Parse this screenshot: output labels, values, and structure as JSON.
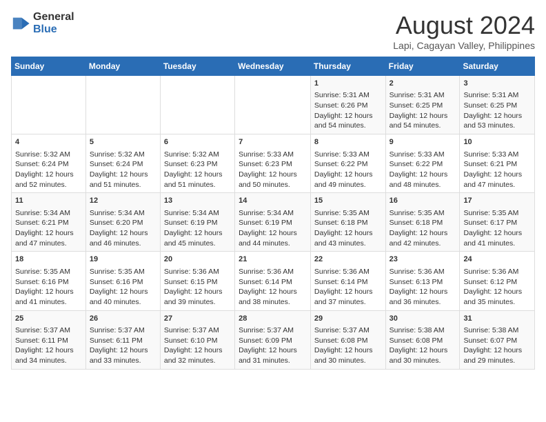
{
  "header": {
    "logo_general": "General",
    "logo_blue": "Blue",
    "month_title": "August 2024",
    "location": "Lapi, Cagayan Valley, Philippines"
  },
  "days_of_week": [
    "Sunday",
    "Monday",
    "Tuesday",
    "Wednesday",
    "Thursday",
    "Friday",
    "Saturday"
  ],
  "weeks": [
    [
      {
        "day": "",
        "info": ""
      },
      {
        "day": "",
        "info": ""
      },
      {
        "day": "",
        "info": ""
      },
      {
        "day": "",
        "info": ""
      },
      {
        "day": "1",
        "info": "Sunrise: 5:31 AM\nSunset: 6:26 PM\nDaylight: 12 hours\nand 54 minutes."
      },
      {
        "day": "2",
        "info": "Sunrise: 5:31 AM\nSunset: 6:25 PM\nDaylight: 12 hours\nand 54 minutes."
      },
      {
        "day": "3",
        "info": "Sunrise: 5:31 AM\nSunset: 6:25 PM\nDaylight: 12 hours\nand 53 minutes."
      }
    ],
    [
      {
        "day": "4",
        "info": "Sunrise: 5:32 AM\nSunset: 6:24 PM\nDaylight: 12 hours\nand 52 minutes."
      },
      {
        "day": "5",
        "info": "Sunrise: 5:32 AM\nSunset: 6:24 PM\nDaylight: 12 hours\nand 51 minutes."
      },
      {
        "day": "6",
        "info": "Sunrise: 5:32 AM\nSunset: 6:23 PM\nDaylight: 12 hours\nand 51 minutes."
      },
      {
        "day": "7",
        "info": "Sunrise: 5:33 AM\nSunset: 6:23 PM\nDaylight: 12 hours\nand 50 minutes."
      },
      {
        "day": "8",
        "info": "Sunrise: 5:33 AM\nSunset: 6:22 PM\nDaylight: 12 hours\nand 49 minutes."
      },
      {
        "day": "9",
        "info": "Sunrise: 5:33 AM\nSunset: 6:22 PM\nDaylight: 12 hours\nand 48 minutes."
      },
      {
        "day": "10",
        "info": "Sunrise: 5:33 AM\nSunset: 6:21 PM\nDaylight: 12 hours\nand 47 minutes."
      }
    ],
    [
      {
        "day": "11",
        "info": "Sunrise: 5:34 AM\nSunset: 6:21 PM\nDaylight: 12 hours\nand 47 minutes."
      },
      {
        "day": "12",
        "info": "Sunrise: 5:34 AM\nSunset: 6:20 PM\nDaylight: 12 hours\nand 46 minutes."
      },
      {
        "day": "13",
        "info": "Sunrise: 5:34 AM\nSunset: 6:19 PM\nDaylight: 12 hours\nand 45 minutes."
      },
      {
        "day": "14",
        "info": "Sunrise: 5:34 AM\nSunset: 6:19 PM\nDaylight: 12 hours\nand 44 minutes."
      },
      {
        "day": "15",
        "info": "Sunrise: 5:35 AM\nSunset: 6:18 PM\nDaylight: 12 hours\nand 43 minutes."
      },
      {
        "day": "16",
        "info": "Sunrise: 5:35 AM\nSunset: 6:18 PM\nDaylight: 12 hours\nand 42 minutes."
      },
      {
        "day": "17",
        "info": "Sunrise: 5:35 AM\nSunset: 6:17 PM\nDaylight: 12 hours\nand 41 minutes."
      }
    ],
    [
      {
        "day": "18",
        "info": "Sunrise: 5:35 AM\nSunset: 6:16 PM\nDaylight: 12 hours\nand 41 minutes."
      },
      {
        "day": "19",
        "info": "Sunrise: 5:35 AM\nSunset: 6:16 PM\nDaylight: 12 hours\nand 40 minutes."
      },
      {
        "day": "20",
        "info": "Sunrise: 5:36 AM\nSunset: 6:15 PM\nDaylight: 12 hours\nand 39 minutes."
      },
      {
        "day": "21",
        "info": "Sunrise: 5:36 AM\nSunset: 6:14 PM\nDaylight: 12 hours\nand 38 minutes."
      },
      {
        "day": "22",
        "info": "Sunrise: 5:36 AM\nSunset: 6:14 PM\nDaylight: 12 hours\nand 37 minutes."
      },
      {
        "day": "23",
        "info": "Sunrise: 5:36 AM\nSunset: 6:13 PM\nDaylight: 12 hours\nand 36 minutes."
      },
      {
        "day": "24",
        "info": "Sunrise: 5:36 AM\nSunset: 6:12 PM\nDaylight: 12 hours\nand 35 minutes."
      }
    ],
    [
      {
        "day": "25",
        "info": "Sunrise: 5:37 AM\nSunset: 6:11 PM\nDaylight: 12 hours\nand 34 minutes."
      },
      {
        "day": "26",
        "info": "Sunrise: 5:37 AM\nSunset: 6:11 PM\nDaylight: 12 hours\nand 33 minutes."
      },
      {
        "day": "27",
        "info": "Sunrise: 5:37 AM\nSunset: 6:10 PM\nDaylight: 12 hours\nand 32 minutes."
      },
      {
        "day": "28",
        "info": "Sunrise: 5:37 AM\nSunset: 6:09 PM\nDaylight: 12 hours\nand 31 minutes."
      },
      {
        "day": "29",
        "info": "Sunrise: 5:37 AM\nSunset: 6:08 PM\nDaylight: 12 hours\nand 30 minutes."
      },
      {
        "day": "30",
        "info": "Sunrise: 5:38 AM\nSunset: 6:08 PM\nDaylight: 12 hours\nand 30 minutes."
      },
      {
        "day": "31",
        "info": "Sunrise: 5:38 AM\nSunset: 6:07 PM\nDaylight: 12 hours\nand 29 minutes."
      }
    ]
  ]
}
